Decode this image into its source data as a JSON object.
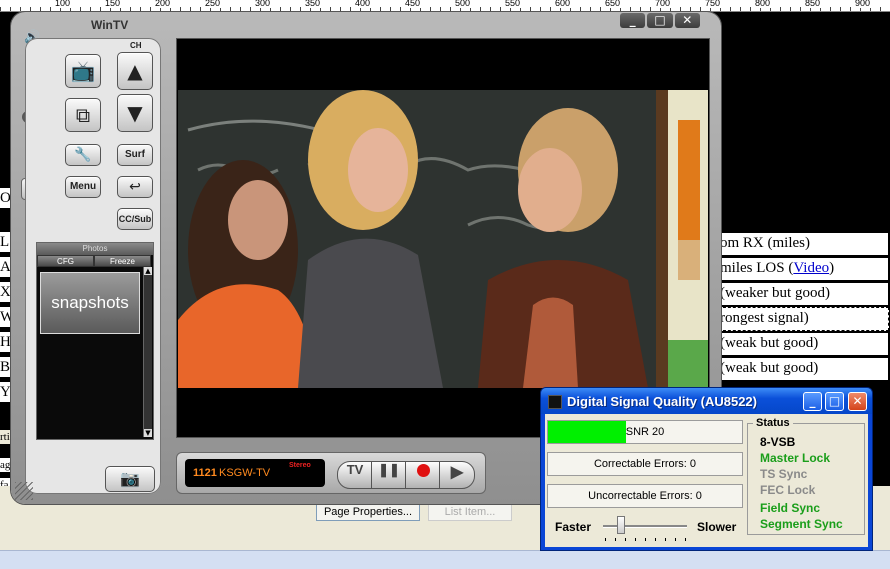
{
  "ruler": {
    "ticks": [
      "100",
      "150",
      "200",
      "250",
      "300",
      "350",
      "400",
      "450",
      "500",
      "550",
      "600",
      "650",
      "700",
      "750",
      "800",
      "850",
      "900"
    ]
  },
  "background": {
    "left_chars": [
      "L",
      "A",
      "X",
      "W",
      "H",
      "B",
      "Y"
    ],
    "table_cells": [
      {
        "text": "om RX (miles)"
      },
      {
        "text_before": "miles LOS (",
        "link": "Video",
        "text_after": ")"
      },
      {
        "text": "(weaker but good)"
      },
      {
        "text": "rongest signal)"
      },
      {
        "text": "(weak but good)"
      },
      {
        "text": "(weak but good)"
      }
    ],
    "left_strip_labels": [
      "rti",
      "ag",
      "fa"
    ],
    "page_properties_label": "Page Properties...",
    "list_item_label": "List Item..."
  },
  "wintv": {
    "title": "WinTV",
    "window_buttons": [
      "_",
      "□",
      "✕"
    ],
    "ch_label": "CH",
    "buttons": {
      "surf": "Surf",
      "menu": "Menu",
      "cc_sub": "CC/Sub"
    },
    "snapshots": {
      "tab_top": "Photos",
      "tab_left": "CFG",
      "tab_right": "Freeze",
      "label": "snapshots"
    },
    "transport": {
      "channel_number": "1121",
      "channel_name": "KSGW-TV",
      "audio_mode": "Stereo",
      "tv_label": "TV"
    }
  },
  "dsq": {
    "title": "Digital Signal Quality (AU8522)",
    "snr_label": "SNR 20",
    "snr_level_percent": 40,
    "correctable": "Correctable Errors:  0",
    "uncorrectable": "Uncorrectable Errors:  0",
    "faster": "Faster",
    "slower": "Slower",
    "status_title": "Status",
    "status_items": [
      {
        "label": "8-VSB",
        "color": "#000000"
      },
      {
        "label": "Master Lock",
        "color": "#1a9e1a"
      },
      {
        "label": "TS Sync",
        "color": "#8a8a8a"
      },
      {
        "label": "FEC Lock",
        "color": "#8a8a8a"
      },
      {
        "label": "Field Sync",
        "color": "#1a9e1a"
      },
      {
        "label": "Segment Sync",
        "color": "#1a9e1a"
      }
    ]
  }
}
